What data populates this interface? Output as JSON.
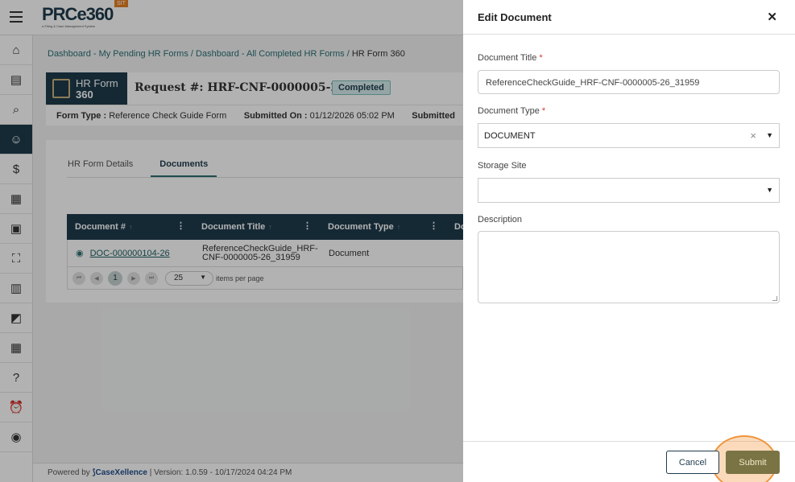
{
  "app": {
    "logo_text": "PRCe360",
    "logo_sub": "e-Filing & Case Management System",
    "env_badge": "SIT"
  },
  "sidebar": {
    "items": [
      {
        "icon": "bank-icon"
      },
      {
        "icon": "document-icon"
      },
      {
        "icon": "search-document-icon"
      },
      {
        "icon": "users-icon",
        "active": true
      },
      {
        "icon": "dollar-document-icon"
      },
      {
        "icon": "building-icon"
      },
      {
        "icon": "form-icon"
      },
      {
        "icon": "scan-icon"
      },
      {
        "icon": "book-icon"
      },
      {
        "icon": "chart-icon"
      },
      {
        "icon": "calendar-icon"
      },
      {
        "icon": "help-icon"
      },
      {
        "icon": "alarm-icon"
      },
      {
        "icon": "user-circle-icon"
      }
    ]
  },
  "breadcrumb": {
    "item1": "Dashboard - My Pending HR Forms",
    "item2": "Dashboard - All Completed HR Forms",
    "current": "HR Form 360",
    "sep": " / "
  },
  "request": {
    "badge_line1": "HR Form",
    "badge_line2": "360",
    "title": "Request #: HRF-CNF-0000005-26",
    "status": "Completed",
    "form_type_label": "Form Type :",
    "form_type_value": "Reference Check Guide Form",
    "submitted_on_label": "Submitted On :",
    "submitted_on_value": "01/12/2026 05:02 PM",
    "submitted_by_label": "Submitted"
  },
  "tabs": [
    {
      "label": "HR Form Details",
      "active": false
    },
    {
      "label": "Documents",
      "active": true
    }
  ],
  "grid": {
    "columns": [
      "Document #",
      "Document Title",
      "Document Type",
      "Do"
    ],
    "rows": [
      {
        "doc_no": "DOC-000000104-26",
        "title": "ReferenceCheckGuide_HRF-CNF-0000005-26_31959",
        "type": "Document"
      }
    ],
    "pager": {
      "page": "1",
      "per_page": "25",
      "per_page_label": "items per page"
    }
  },
  "footer": {
    "powered_by": "Powered by",
    "brand": "CaseXellence",
    "version": "|  Version: 1.0.59 - 10/17/2024 04:24 PM"
  },
  "drawer": {
    "title": "Edit Document",
    "doc_title_label": "Document Title",
    "doc_title_value": "ReferenceCheckGuide_HRF-CNF-0000005-26_31959",
    "doc_type_label": "Document Type",
    "doc_type_value": "DOCUMENT",
    "storage_site_label": "Storage Site",
    "storage_site_value": "",
    "description_label": "Description",
    "description_value": "",
    "cancel_label": "Cancel",
    "submit_label": "Submit"
  }
}
